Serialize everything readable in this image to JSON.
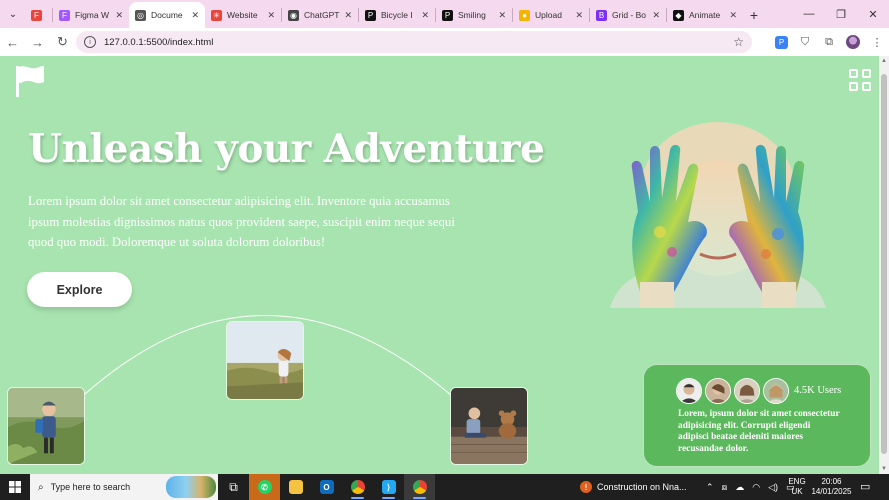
{
  "browser": {
    "tabs": [
      {
        "label": "",
        "favicon_color": "#e8453c",
        "favicon_glyph": "F",
        "pinned": true,
        "active": false
      },
      {
        "label": "Figma W",
        "favicon_color": "#a259ff",
        "favicon_glyph": "F",
        "pinned": false,
        "active": false
      },
      {
        "label": "Docume",
        "favicon_color": "#555555",
        "favicon_glyph": "◎",
        "pinned": false,
        "active": true
      },
      {
        "label": "Website",
        "favicon_color": "#e8453c",
        "favicon_glyph": "✳",
        "pinned": false,
        "active": false
      },
      {
        "label": "ChatGPT",
        "favicon_color": "#444444",
        "favicon_glyph": "◉",
        "pinned": false,
        "active": false
      },
      {
        "label": "Bicycle I",
        "favicon_color": "#111111",
        "favicon_glyph": "P",
        "pinned": false,
        "active": false
      },
      {
        "label": "Smiling",
        "favicon_color": "#111111",
        "favicon_glyph": "P",
        "pinned": false,
        "active": false
      },
      {
        "label": "Upload",
        "favicon_color": "#f5b400",
        "favicon_glyph": "●",
        "pinned": false,
        "active": false
      },
      {
        "label": "Grid - Bo",
        "favicon_color": "#7b2ff7",
        "favicon_glyph": "B",
        "pinned": false,
        "active": false
      },
      {
        "label": "Animate",
        "favicon_color": "#111111",
        "favicon_glyph": "◆",
        "pinned": false,
        "active": false
      }
    ],
    "url": "127.0.0.1:5500/index.html"
  },
  "page": {
    "hero": {
      "title": "Unleash your Adventure",
      "description": "Lorem ipsum dolor sit amet consectetur adipisicing elit. Inventore quia accusamus ipsum molestias dignissimos natus quos provident saepe, suscipit enim neque sequi quod quo modi. Doloremque ut soluta dolorum doloribus!",
      "button_label": "Explore"
    },
    "users_card": {
      "count": "4.5K Users",
      "text": "Lorem, ipsum dolor sit amet consectetur adipisicing elit. Corrupti eligendi adipisci beatae deleniti maiores recusandae dolor."
    },
    "colors": {
      "background": "#a8e4b0",
      "card": "#5cb85c",
      "text": "#ffffff"
    }
  },
  "taskbar": {
    "search_placeholder": "Type here to search",
    "notification": "Construction on Nna...",
    "language_line1": "ENG",
    "language_line2": "UK",
    "time": "20:06",
    "date": "14/01/2025"
  }
}
